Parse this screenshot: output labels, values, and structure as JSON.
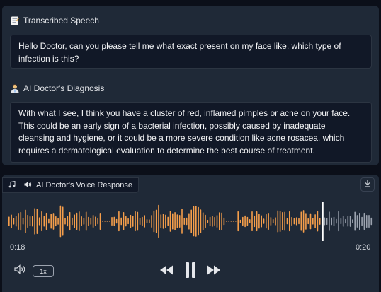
{
  "speech": {
    "label": "Transcribed Speech",
    "text": "Hello Doctor, can you please tell me what exact present on my face like, which type of infection is this?"
  },
  "diagnosis": {
    "label": "AI Doctor's Diagnosis",
    "text": "With what I see, I think you have a cluster of red, inflamed pimples or acne on your face. This could be an early sign of a bacterial infection, possibly caused by inadequate cleansing and hygiene, or it could be a more severe condition like acne rosacea, which requires a dermatological evaluation to determine the best course of treatment."
  },
  "audio": {
    "label": "AI Doctor's Voice Response",
    "current_time": "0:18",
    "duration": "0:20",
    "progress": 0.86,
    "playback_rate": "1x",
    "played_color": "#f59e4b",
    "unplayed_color": "#9ca3af"
  },
  "icons": {
    "speech": "memo-icon",
    "diagnosis": "doctor-icon",
    "audio_block": "music-note-icon",
    "voice": "speaker-icon",
    "download": "download-icon",
    "volume": "volume-icon",
    "rewind": "rewind-icon",
    "pause": "pause-icon",
    "forward": "fast-forward-icon"
  }
}
